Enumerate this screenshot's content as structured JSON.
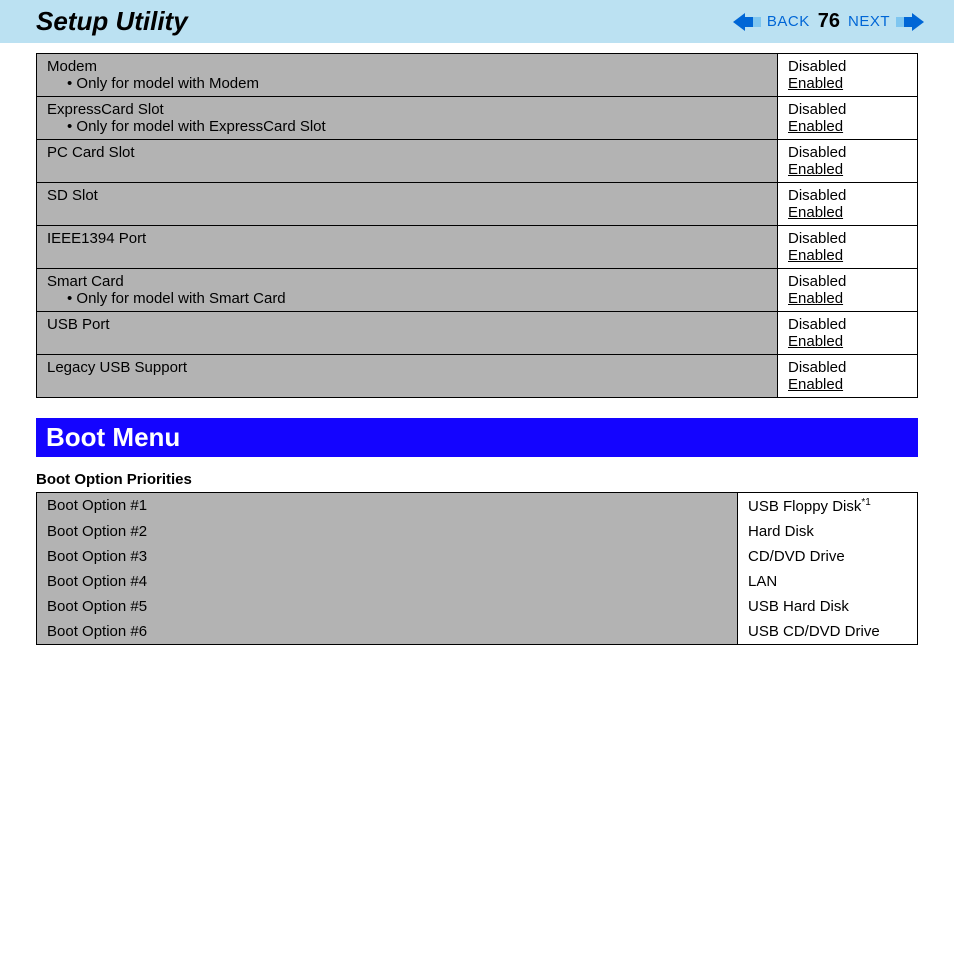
{
  "header": {
    "title": "Setup Utility",
    "back": "BACK",
    "next": "NEXT",
    "page": "76"
  },
  "settings": [
    {
      "name": "Modem",
      "note": "Only for model with Modem",
      "opt1": "Disabled",
      "opt2": "Enabled"
    },
    {
      "name": "ExpressCard Slot",
      "note": "Only for model with ExpressCard Slot",
      "opt1": "Disabled",
      "opt2": "Enabled"
    },
    {
      "name": "PC Card Slot",
      "note": "",
      "opt1": "Disabled",
      "opt2": "Enabled"
    },
    {
      "name": "SD Slot",
      "note": "",
      "opt1": "Disabled",
      "opt2": "Enabled"
    },
    {
      "name": "IEEE1394 Port",
      "note": "",
      "opt1": "Disabled",
      "opt2": "Enabled"
    },
    {
      "name": "Smart Card",
      "note": "Only for model with Smart Card",
      "opt1": "Disabled",
      "opt2": "Enabled"
    },
    {
      "name": "USB Port",
      "note": "",
      "opt1": "Disabled",
      "opt2": "Enabled"
    },
    {
      "name": "Legacy USB Support",
      "note": "",
      "opt1": "Disabled",
      "opt2": "Enabled"
    }
  ],
  "boot": {
    "banner": "Boot Menu",
    "subheading": "Boot Option Priorities",
    "options": [
      {
        "label": "Boot Option #1",
        "value": "USB Floppy Disk",
        "sup": "*1"
      },
      {
        "label": "Boot Option #2",
        "value": "Hard Disk",
        "sup": ""
      },
      {
        "label": "Boot Option #3",
        "value": "CD/DVD Drive",
        "sup": ""
      },
      {
        "label": "Boot Option #4",
        "value": "LAN",
        "sup": ""
      },
      {
        "label": "Boot Option #5",
        "value": "USB Hard Disk",
        "sup": ""
      },
      {
        "label": "Boot Option #6",
        "value": "USB CD/DVD Drive",
        "sup": ""
      }
    ]
  }
}
